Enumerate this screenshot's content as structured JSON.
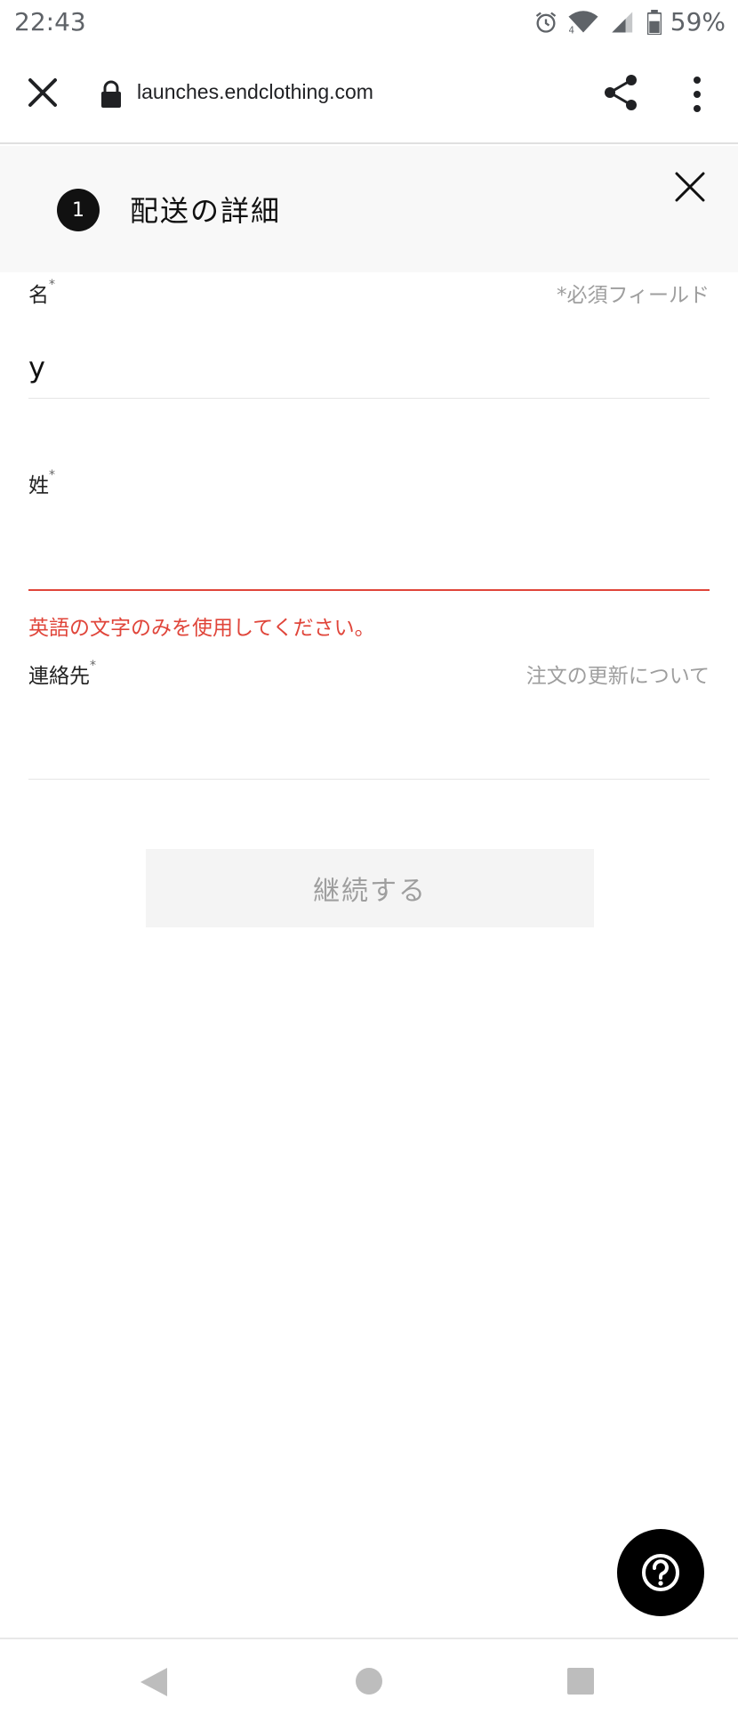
{
  "status_bar": {
    "time": "22:43",
    "battery": "59%",
    "icons": [
      "alarm-icon",
      "wifi-icon",
      "signal-icon",
      "battery-icon"
    ]
  },
  "browser": {
    "url": "launches.endclothing.com",
    "icons": [
      "close-icon",
      "lock-icon",
      "share-icon",
      "more-vert-icon"
    ]
  },
  "step": {
    "number": "1",
    "title": "配送の詳細"
  },
  "form": {
    "required_hint": "*必須フィールド",
    "first_name": {
      "label": "名",
      "value": "y"
    },
    "last_name": {
      "label": "姓",
      "value": "",
      "error": "英語の文字のみを使用してください。"
    },
    "contact": {
      "label": "連絡先",
      "hint": "注文の更新について",
      "value": ""
    },
    "required_mark": "*"
  },
  "continue_button": {
    "label": "継続する"
  },
  "colors": {
    "error": "#e0453a",
    "accent": "#111111",
    "muted": "#9e9e9e",
    "panel_bg": "#f8f8f8"
  }
}
